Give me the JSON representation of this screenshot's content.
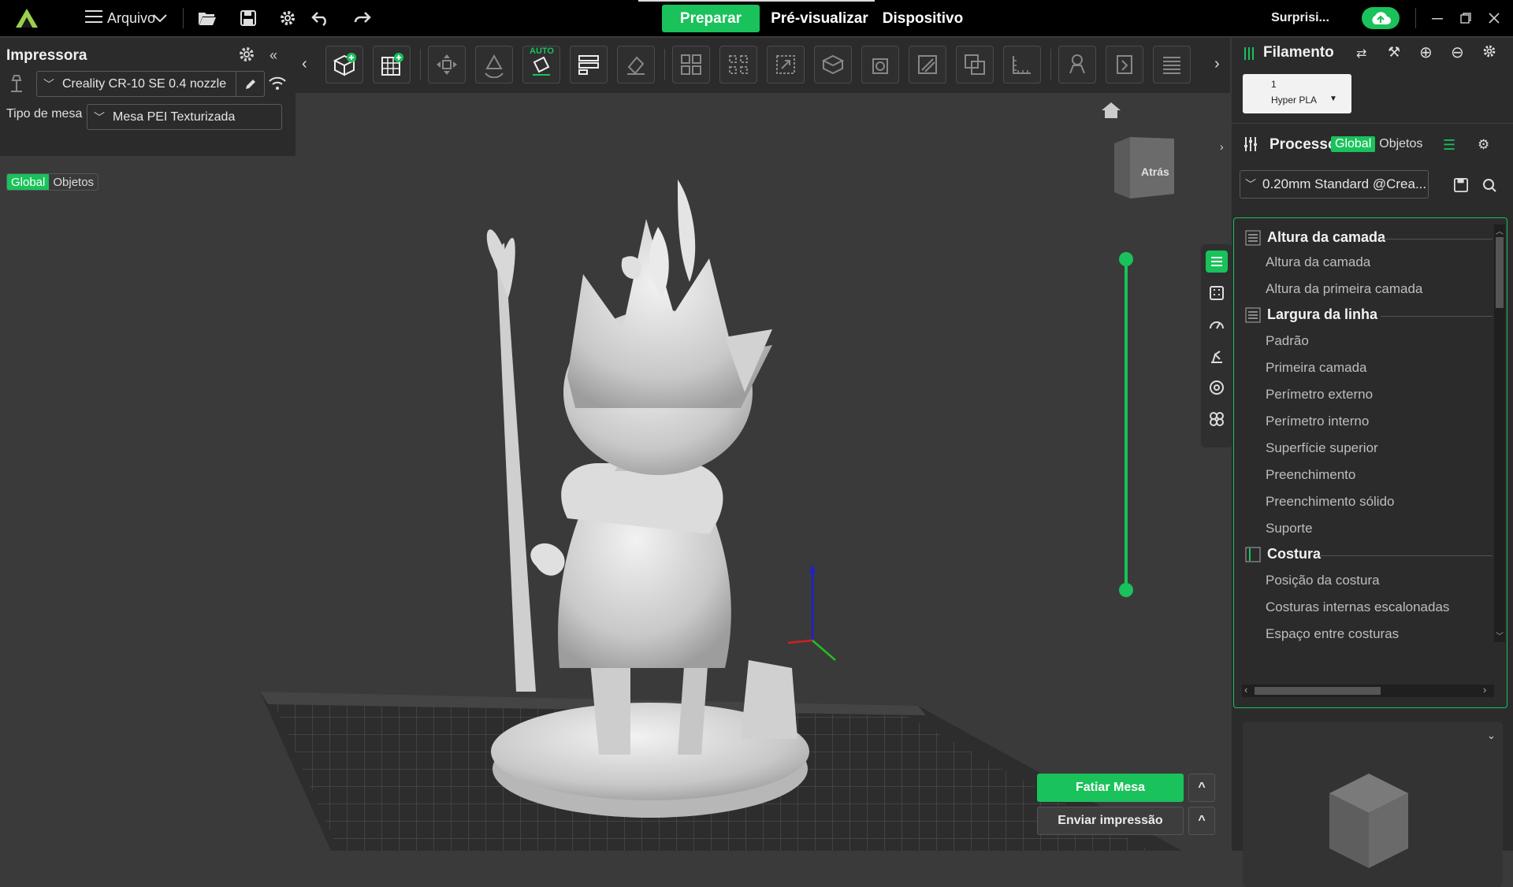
{
  "topbar": {
    "menu_label": "Arquivo",
    "tabs": [
      "Preparar",
      "Pré-visualizar",
      "Dispositivo"
    ],
    "user": "Surprisi..."
  },
  "printer": {
    "title": "Impressora",
    "model": "Creality CR-10 SE 0.4 nozzle",
    "bed_label": "Tipo de mesa",
    "bed_value": "Mesa PEI Texturizada",
    "scope_global": "Global",
    "scope_objects": "Objetos"
  },
  "toolbar": {
    "auto_label": "AUTO"
  },
  "viewport": {
    "cube_label": "Atrás"
  },
  "filament": {
    "title": "Filamento",
    "slot_number": "1",
    "slot_name": "Hyper PLA"
  },
  "process": {
    "title": "Processo",
    "scope_global": "Global",
    "scope_objects": "Objetos",
    "preset": "0.20mm Standard @Crea...",
    "sections": [
      {
        "title": "Altura da camada",
        "items": [
          "Altura da camada",
          "Altura da primeira camada"
        ]
      },
      {
        "title": "Largura da linha",
        "items": [
          "Padrão",
          "Primeira camada",
          "Perímetro externo",
          "Perímetro interno",
          "Superfície superior",
          "Preenchimento",
          "Preenchimento sólido",
          "Suporte"
        ]
      },
      {
        "title": "Costura",
        "items": [
          "Posição da costura",
          "Costuras internas escalonadas",
          "Espaço entre costuras"
        ]
      }
    ]
  },
  "actions": {
    "slice": "Fatiar Mesa",
    "send": "Enviar impressão"
  },
  "colors": {
    "accent": "#19c25a",
    "background": "#3a3a3b",
    "panel": "#2b2b2c"
  }
}
